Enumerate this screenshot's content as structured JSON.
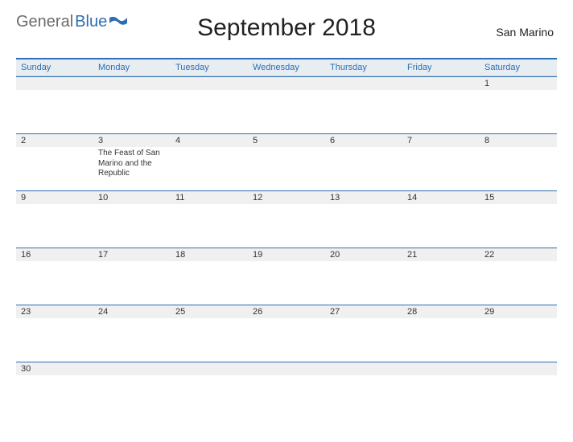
{
  "logo": {
    "text1": "General",
    "text2": "Blue"
  },
  "title": "September 2018",
  "region": "San Marino",
  "weekdays": [
    "Sunday",
    "Monday",
    "Tuesday",
    "Wednesday",
    "Thursday",
    "Friday",
    "Saturday"
  ],
  "weeks": [
    [
      {
        "day": "",
        "event": ""
      },
      {
        "day": "",
        "event": ""
      },
      {
        "day": "",
        "event": ""
      },
      {
        "day": "",
        "event": ""
      },
      {
        "day": "",
        "event": ""
      },
      {
        "day": "",
        "event": ""
      },
      {
        "day": "1",
        "event": ""
      }
    ],
    [
      {
        "day": "2",
        "event": ""
      },
      {
        "day": "3",
        "event": "The Feast of San Marino and the Republic"
      },
      {
        "day": "4",
        "event": ""
      },
      {
        "day": "5",
        "event": ""
      },
      {
        "day": "6",
        "event": ""
      },
      {
        "day": "7",
        "event": ""
      },
      {
        "day": "8",
        "event": ""
      }
    ],
    [
      {
        "day": "9",
        "event": ""
      },
      {
        "day": "10",
        "event": ""
      },
      {
        "day": "11",
        "event": ""
      },
      {
        "day": "12",
        "event": ""
      },
      {
        "day": "13",
        "event": ""
      },
      {
        "day": "14",
        "event": ""
      },
      {
        "day": "15",
        "event": ""
      }
    ],
    [
      {
        "day": "16",
        "event": ""
      },
      {
        "day": "17",
        "event": ""
      },
      {
        "day": "18",
        "event": ""
      },
      {
        "day": "19",
        "event": ""
      },
      {
        "day": "20",
        "event": ""
      },
      {
        "day": "21",
        "event": ""
      },
      {
        "day": "22",
        "event": ""
      }
    ],
    [
      {
        "day": "23",
        "event": ""
      },
      {
        "day": "24",
        "event": ""
      },
      {
        "day": "25",
        "event": ""
      },
      {
        "day": "26",
        "event": ""
      },
      {
        "day": "27",
        "event": ""
      },
      {
        "day": "28",
        "event": ""
      },
      {
        "day": "29",
        "event": ""
      }
    ],
    [
      {
        "day": "30",
        "event": ""
      },
      {
        "day": "",
        "event": ""
      },
      {
        "day": "",
        "event": ""
      },
      {
        "day": "",
        "event": ""
      },
      {
        "day": "",
        "event": ""
      },
      {
        "day": "",
        "event": ""
      },
      {
        "day": "",
        "event": ""
      }
    ]
  ]
}
